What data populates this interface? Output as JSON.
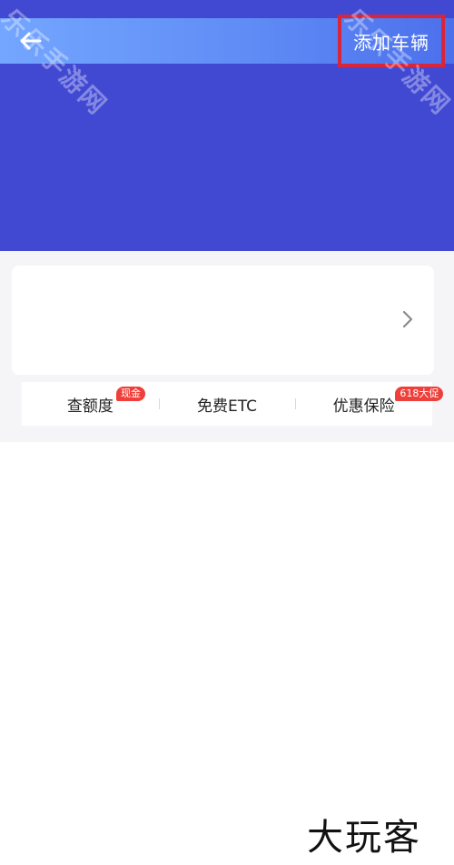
{
  "header": {
    "back_icon": "arrow-left-icon",
    "add_vehicle_label": "添加车辆",
    "background_color": "#4149d3",
    "highlight_color": "#d9253a"
  },
  "vehicle_card": {
    "chevron_icon": "chevron-right-icon"
  },
  "services": [
    {
      "label": "查额度",
      "badge": "现金"
    },
    {
      "label": "免费ETC",
      "badge": ""
    },
    {
      "label": "优惠保险",
      "badge": "618大促"
    }
  ],
  "watermarks": {
    "left": "乐乐手游网",
    "right": "乐乐手游网"
  },
  "brand": "大玩客"
}
